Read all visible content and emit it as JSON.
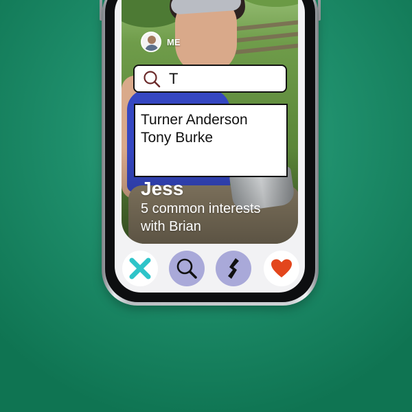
{
  "profile_bar": {
    "me_label": "ME"
  },
  "search": {
    "query": "T",
    "placeholder": ""
  },
  "results": [
    "Turner Anderson",
    "Tony Burke"
  ],
  "profile": {
    "name": "Jess",
    "common_interests": "5 common interests with Brian"
  },
  "actions": [
    {
      "icon": "close-x-icon",
      "color": "#2ec4c9"
    },
    {
      "icon": "search-icon",
      "color": "#a9a9d9"
    },
    {
      "icon": "bolt-icon",
      "color": "#a9a9d9"
    },
    {
      "icon": "heart-icon",
      "color": "#e3461c"
    }
  ],
  "colors": {
    "background": "#1f8f6c",
    "accent_teal": "#2ec4c9",
    "accent_lavender": "#a9a9d9",
    "heart_orange": "#e3461c"
  }
}
